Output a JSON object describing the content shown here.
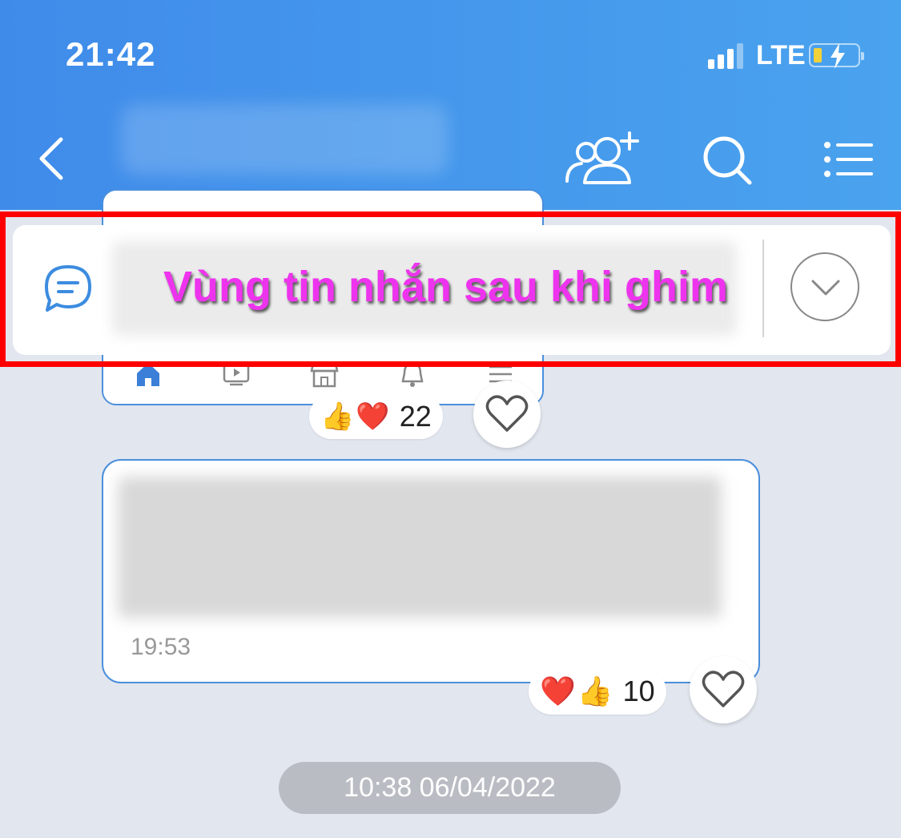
{
  "status_bar": {
    "time": "21:42",
    "network": "LTE",
    "signal_bars": 4,
    "signal_active": 3
  },
  "header": {
    "back_icon": "chevron-left-icon",
    "add_member_icon": "add-user-icon",
    "search_icon": "search-icon",
    "menu_icon": "list-menu-icon"
  },
  "pinned_message": {
    "icon": "chat-bubble-icon",
    "annotation": "Vùng tin nhắn sau khi ghim",
    "expand_icon": "chevron-down-icon"
  },
  "image_message": {
    "reactions": [
      "👍",
      "❤️"
    ],
    "reaction_count": "22",
    "tabbar_icons": [
      "home-icon",
      "video-icon",
      "shop-icon",
      "bell-icon",
      "menu-icon"
    ]
  },
  "text_message": {
    "time": "19:53",
    "reactions": [
      "❤️",
      "👍"
    ],
    "reaction_count": "10"
  },
  "date_separator": "10:38 06/04/2022",
  "colors": {
    "header_start": "#3f8bea",
    "header_end": "#4aa3ee",
    "accent": "#4a8fdc",
    "annotation": "#ee33ee",
    "highlight_border": "#ff0000",
    "background": "#e2e6ee"
  }
}
